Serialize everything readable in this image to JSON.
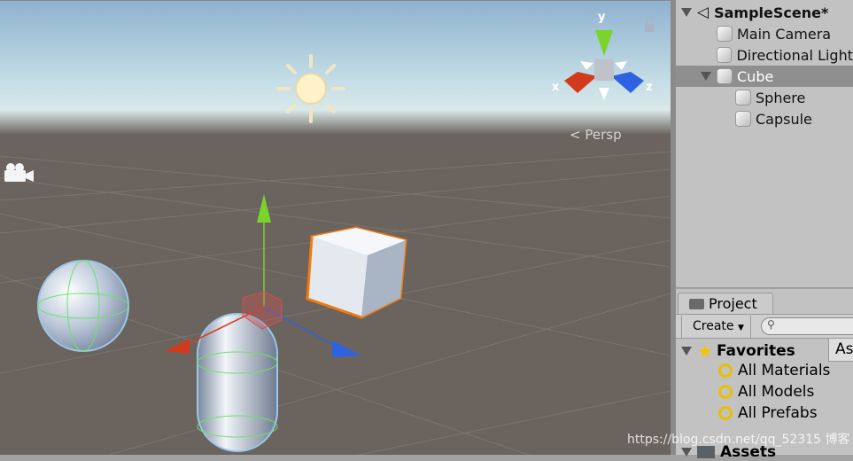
{
  "scene_view": {
    "gizmo_axes": {
      "x": "x",
      "y": "y",
      "z": "z"
    },
    "projection_label": "Persp",
    "colors": {
      "x_axis": "#d23a1e",
      "y_axis": "#7ad42a",
      "z_axis": "#2f62e0",
      "selection_outline": "#f07a10"
    },
    "icons": [
      "sun-icon",
      "camera-icon",
      "lock-icon"
    ]
  },
  "hierarchy": {
    "scene": "SampleScene*",
    "items": [
      {
        "label": "Main Camera",
        "depth": 1,
        "selected": false
      },
      {
        "label": "Directional Light",
        "depth": 1,
        "selected": false
      },
      {
        "label": "Cube",
        "depth": 1,
        "selected": true,
        "expanded": true
      },
      {
        "label": "Sphere",
        "depth": 2,
        "selected": false
      },
      {
        "label": "Capsule",
        "depth": 2,
        "selected": false
      }
    ]
  },
  "project": {
    "tab": "Project",
    "create_label": "Create",
    "search_placeholder": "",
    "favorites": "Favorites",
    "favorite_items": [
      "All Materials",
      "All Models",
      "All Prefabs"
    ],
    "assets": "Assets",
    "right_header": "Assets"
  },
  "watermark": "https://blog.csdn.net/qq_52315 博客"
}
